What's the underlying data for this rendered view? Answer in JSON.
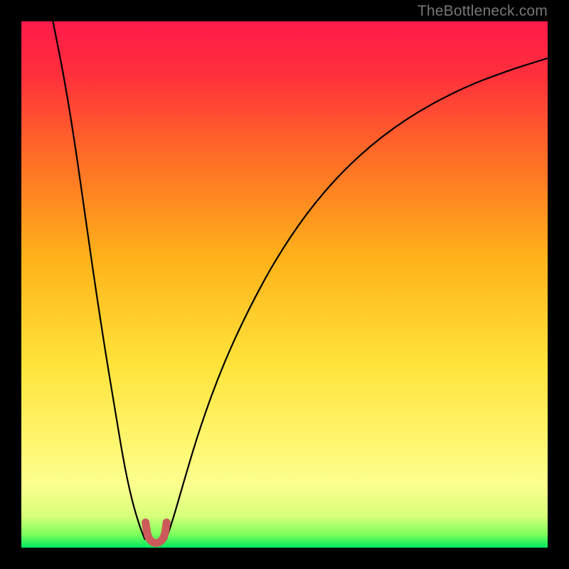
{
  "watermark": "TheBottleneck.com",
  "chart_data": {
    "type": "line",
    "title": "",
    "xlabel": "",
    "ylabel": "",
    "xlim": [
      0,
      100
    ],
    "ylim": [
      0,
      100
    ],
    "gradient_stops": [
      {
        "offset": 0.0,
        "color": "#ff1a4b"
      },
      {
        "offset": 0.1,
        "color": "#ff2f3c"
      },
      {
        "offset": 0.25,
        "color": "#ff6a27"
      },
      {
        "offset": 0.45,
        "color": "#ffb21a"
      },
      {
        "offset": 0.65,
        "color": "#ffe33a"
      },
      {
        "offset": 0.8,
        "color": "#fff66f"
      },
      {
        "offset": 0.88,
        "color": "#fbff8e"
      },
      {
        "offset": 0.94,
        "color": "#d8ff7a"
      },
      {
        "offset": 0.975,
        "color": "#7dff5d"
      },
      {
        "offset": 1.0,
        "color": "#00e85e"
      }
    ],
    "series": [
      {
        "name": "left-arm",
        "stroke": "#000000",
        "width": 2.2,
        "points": [
          {
            "x": 6.0,
            "y": 100.0
          },
          {
            "x": 8.0,
            "y": 90.0
          },
          {
            "x": 10.0,
            "y": 78.0
          },
          {
            "x": 12.0,
            "y": 64.0
          },
          {
            "x": 14.0,
            "y": 50.0
          },
          {
            "x": 16.0,
            "y": 37.0
          },
          {
            "x": 18.0,
            "y": 25.0
          },
          {
            "x": 19.5,
            "y": 16.0
          },
          {
            "x": 21.0,
            "y": 9.0
          },
          {
            "x": 22.5,
            "y": 4.0
          },
          {
            "x": 23.5,
            "y": 1.5
          }
        ]
      },
      {
        "name": "right-arm",
        "stroke": "#000000",
        "width": 2.2,
        "points": [
          {
            "x": 27.5,
            "y": 1.5
          },
          {
            "x": 29.0,
            "y": 6.0
          },
          {
            "x": 31.0,
            "y": 13.0
          },
          {
            "x": 34.0,
            "y": 23.0
          },
          {
            "x": 38.0,
            "y": 34.0
          },
          {
            "x": 43.0,
            "y": 45.0
          },
          {
            "x": 49.0,
            "y": 56.0
          },
          {
            "x": 56.0,
            "y": 66.0
          },
          {
            "x": 64.0,
            "y": 74.5
          },
          {
            "x": 73.0,
            "y": 81.5
          },
          {
            "x": 83.0,
            "y": 87.0
          },
          {
            "x": 92.0,
            "y": 90.5
          },
          {
            "x": 100.0,
            "y": 93.0
          }
        ]
      },
      {
        "name": "valley-marker",
        "stroke": "#cc5a5a",
        "width": 11,
        "cap": "round",
        "points": [
          {
            "x": 23.6,
            "y": 4.8
          },
          {
            "x": 24.0,
            "y": 2.0
          },
          {
            "x": 25.0,
            "y": 0.9
          },
          {
            "x": 26.2,
            "y": 0.9
          },
          {
            "x": 27.2,
            "y": 2.0
          },
          {
            "x": 27.6,
            "y": 4.8
          }
        ]
      }
    ]
  }
}
